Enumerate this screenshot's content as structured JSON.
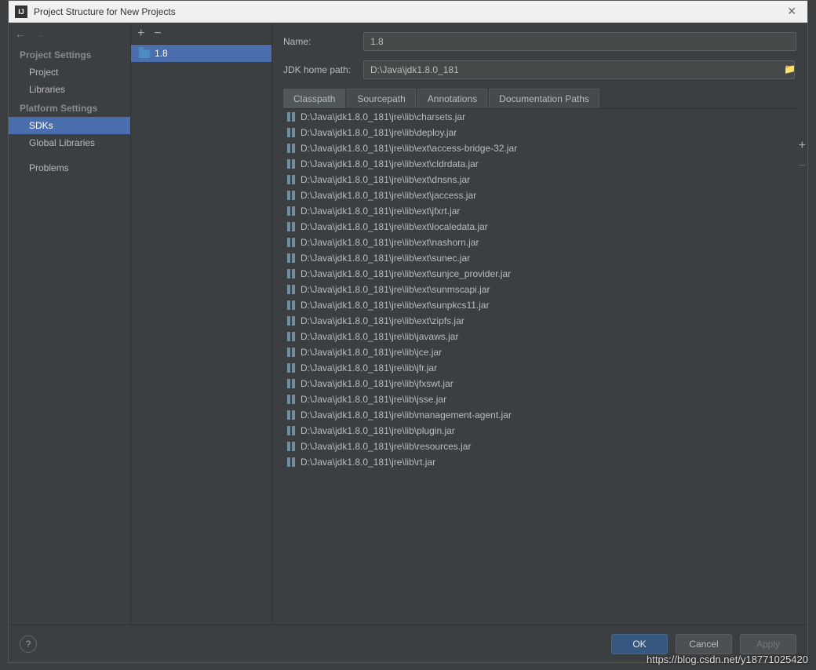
{
  "window": {
    "title": "Project Structure for New Projects"
  },
  "nav": {
    "section1": "Project Settings",
    "items1": [
      "Project",
      "Libraries"
    ],
    "section2": "Platform Settings",
    "items2": [
      "SDKs",
      "Global Libraries"
    ],
    "problems": "Problems"
  },
  "sdkList": {
    "items": [
      "1.8"
    ]
  },
  "form": {
    "nameLabel": "Name:",
    "nameValue": "1.8",
    "homeLabel": "JDK home path:",
    "homeValue": "D:\\Java\\jdk1.8.0_181"
  },
  "tabs": [
    "Classpath",
    "Sourcepath",
    "Annotations",
    "Documentation Paths"
  ],
  "classpath": [
    "D:\\Java\\jdk1.8.0_181\\jre\\lib\\charsets.jar",
    "D:\\Java\\jdk1.8.0_181\\jre\\lib\\deploy.jar",
    "D:\\Java\\jdk1.8.0_181\\jre\\lib\\ext\\access-bridge-32.jar",
    "D:\\Java\\jdk1.8.0_181\\jre\\lib\\ext\\cldrdata.jar",
    "D:\\Java\\jdk1.8.0_181\\jre\\lib\\ext\\dnsns.jar",
    "D:\\Java\\jdk1.8.0_181\\jre\\lib\\ext\\jaccess.jar",
    "D:\\Java\\jdk1.8.0_181\\jre\\lib\\ext\\jfxrt.jar",
    "D:\\Java\\jdk1.8.0_181\\jre\\lib\\ext\\localedata.jar",
    "D:\\Java\\jdk1.8.0_181\\jre\\lib\\ext\\nashorn.jar",
    "D:\\Java\\jdk1.8.0_181\\jre\\lib\\ext\\sunec.jar",
    "D:\\Java\\jdk1.8.0_181\\jre\\lib\\ext\\sunjce_provider.jar",
    "D:\\Java\\jdk1.8.0_181\\jre\\lib\\ext\\sunmscapi.jar",
    "D:\\Java\\jdk1.8.0_181\\jre\\lib\\ext\\sunpkcs11.jar",
    "D:\\Java\\jdk1.8.0_181\\jre\\lib\\ext\\zipfs.jar",
    "D:\\Java\\jdk1.8.0_181\\jre\\lib\\javaws.jar",
    "D:\\Java\\jdk1.8.0_181\\jre\\lib\\jce.jar",
    "D:\\Java\\jdk1.8.0_181\\jre\\lib\\jfr.jar",
    "D:\\Java\\jdk1.8.0_181\\jre\\lib\\jfxswt.jar",
    "D:\\Java\\jdk1.8.0_181\\jre\\lib\\jsse.jar",
    "D:\\Java\\jdk1.8.0_181\\jre\\lib\\management-agent.jar",
    "D:\\Java\\jdk1.8.0_181\\jre\\lib\\plugin.jar",
    "D:\\Java\\jdk1.8.0_181\\jre\\lib\\resources.jar",
    "D:\\Java\\jdk1.8.0_181\\jre\\lib\\rt.jar"
  ],
  "buttons": {
    "ok": "OK",
    "cancel": "Cancel",
    "apply": "Apply"
  },
  "watermark": "https://blog.csdn.net/y18771025420"
}
